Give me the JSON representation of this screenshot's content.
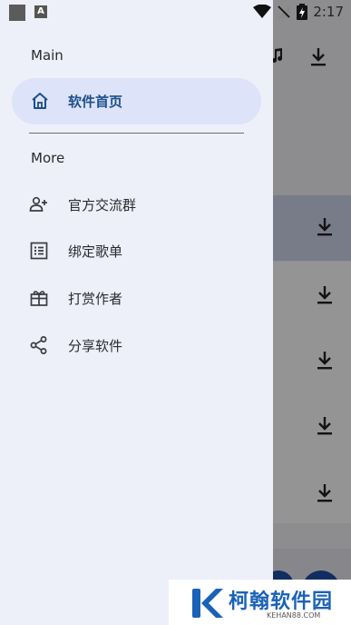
{
  "status_bar": {
    "time": "2:17",
    "notification_icon": "A"
  },
  "drawer": {
    "main_section_label": "Main",
    "home_item_label": "软件首页",
    "more_section_label": "More",
    "items": [
      {
        "label": "官方交流群",
        "icon": "group-add-icon"
      },
      {
        "label": "绑定歌单",
        "icon": "list-box-icon"
      },
      {
        "label": "打赏作者",
        "icon": "gift-icon"
      },
      {
        "label": "分享软件",
        "icon": "share-icon"
      }
    ]
  },
  "watermark": {
    "text": "柯翰软件园",
    "subtext": "KEHAN88.COM"
  },
  "colors": {
    "drawer_bg": "#eef0f9",
    "active_pill": "#dde3f8",
    "active_text": "#1d4f8a",
    "watermark_blue": "#1a62b8"
  }
}
